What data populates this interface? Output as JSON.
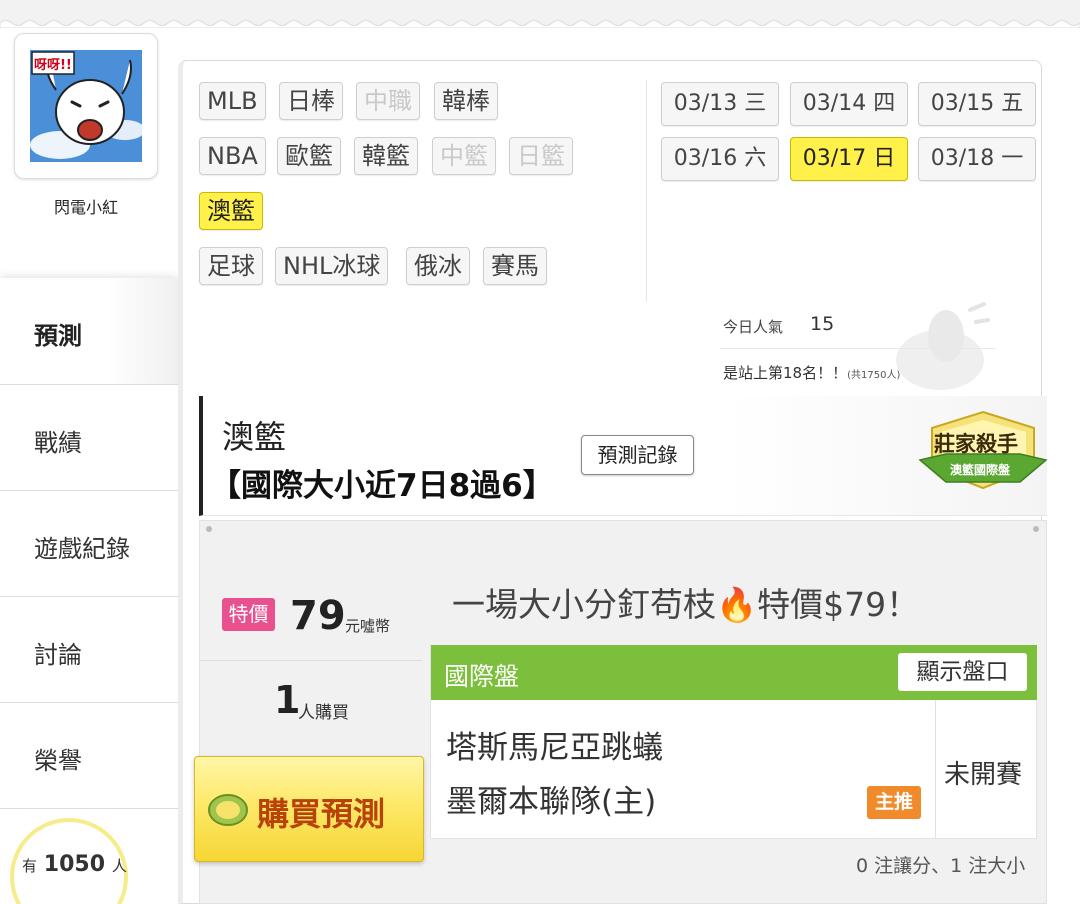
{
  "user": {
    "name": "閃電小紅",
    "avatar_caption": "呀呀!!"
  },
  "nav": {
    "items": [
      {
        "label": "預測",
        "active": true
      },
      {
        "label": "戰績"
      },
      {
        "label": "遊戲紀錄"
      },
      {
        "label": "討論"
      },
      {
        "label": "榮譽"
      }
    ]
  },
  "online": {
    "prefix": "有",
    "count": "1050",
    "suffix": "人"
  },
  "sports": {
    "row1": [
      "MLB",
      "日棒",
      "中職",
      "韓棒"
    ],
    "row2": [
      "NBA",
      "歐籃",
      "韓籃",
      "中籃",
      "日籃"
    ],
    "row3": [
      "澳籃"
    ],
    "row4": [
      "足球",
      "NHL冰球",
      "俄冰",
      "賽馬"
    ]
  },
  "dates": [
    {
      "label": "03/13 三"
    },
    {
      "label": "03/14 四"
    },
    {
      "label": "03/15 五"
    },
    {
      "label": "03/16 六"
    },
    {
      "label": "03/17 日",
      "active": true
    },
    {
      "label": "03/18 一"
    }
  ],
  "popularity": {
    "label": "今日人氣",
    "value": "15",
    "rank_text": "是站上第18名！！",
    "rank_total": "(共1750人)"
  },
  "section": {
    "title": "澳籃",
    "subtitle": "【國際大小近7日8過6】",
    "record_button": "預測記錄",
    "badge_title": "莊家殺手",
    "badge_sub": "澳籃國際盤"
  },
  "offer": {
    "sale_tag": "特價",
    "price": "79",
    "unit": "元噓幣",
    "buyers": "1",
    "buyers_label": "人購買",
    "buy_button": "購買預測",
    "promo_text": "一場大小分釘苟枝🔥特價$79！"
  },
  "game": {
    "market": "國際盤",
    "show_odds": "顯示盤口",
    "team_away": "塔斯馬尼亞跳蟻",
    "team_home": "墨爾本聯隊(主)",
    "recommend": "主推",
    "status": "未開賽",
    "summary": "0 注讓分、1 注大小"
  },
  "colors": {
    "active_yellow": "#fff04a",
    "green_header": "#7cbf3c",
    "sale_pink": "#e8508f",
    "recommend_orange": "#f08a2a"
  }
}
